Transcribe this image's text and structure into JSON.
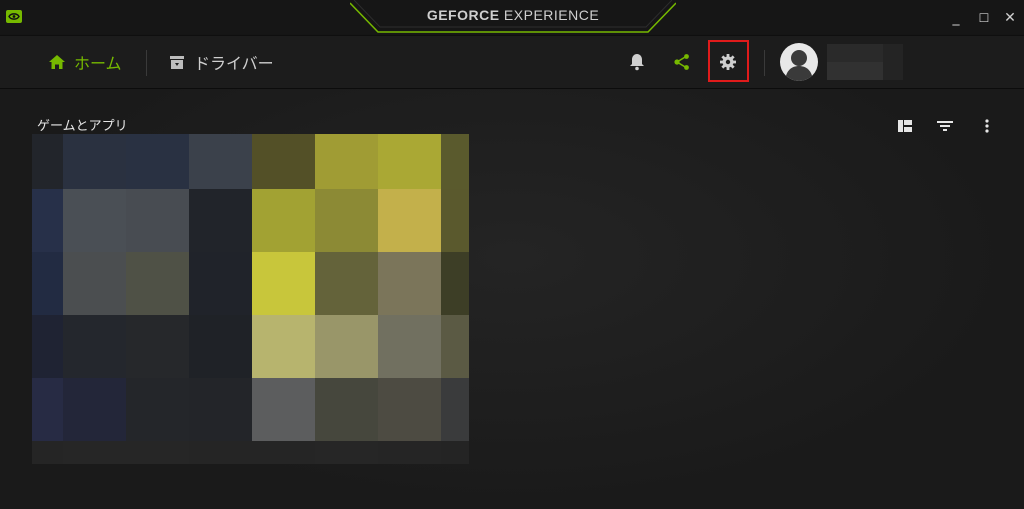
{
  "app": {
    "brand_bold": "GEFORCE",
    "brand_light": " EXPERIENCE",
    "logo_icon": "nvidia-logo-icon"
  },
  "window_controls": {
    "minimize": "_",
    "maximize": "☐",
    "close": "✕"
  },
  "nav": {
    "home_label": "ホーム",
    "drivers_label": "ドライバー",
    "active": "home"
  },
  "actions": [
    "bell-icon",
    "share-icon",
    "gear-icon"
  ],
  "highlight": {
    "target": "settings-button",
    "color": "#e01b1b"
  },
  "main": {
    "section_title": "ゲームとアプリ",
    "toolbar": [
      "grid-view-icon",
      "filter-icon",
      "more-vert-icon"
    ]
  },
  "colors": {
    "accent": "#76b900",
    "bg": "#1a1a1a",
    "text": "#e6e6e6"
  },
  "mosaic_colors": [
    [
      "#22252b",
      "#2a3140",
      "#293142",
      "#3b414b",
      "#535027",
      "#a09c34",
      "#aaa834",
      "#5a5a2d"
    ],
    [
      "#273049",
      "#4a4f55",
      "#484c52",
      "#21242a",
      "#a2a233",
      "#8c8a35",
      "#c3b04b",
      "#5a592d"
    ],
    [
      "#222b42",
      "#4b4e50",
      "#4f5146",
      "#20232a",
      "#c8c63b",
      "#64633a",
      "#7b755a",
      "#3d3e26"
    ],
    [
      "#1f2333",
      "#24272d",
      "#26282b",
      "#1f2227",
      "#b7b46e",
      "#999669",
      "#717060",
      "#5b5a44"
    ],
    [
      "#272b44",
      "#232639",
      "#24262a",
      "#232529",
      "#5c5d5e",
      "#46473d",
      "#4d4b42",
      "#3a3b3c"
    ],
    [
      "#252525",
      "#262626",
      "#262626",
      "#252525",
      "#252525",
      "#262626",
      "#252525",
      "#242424"
    ]
  ]
}
